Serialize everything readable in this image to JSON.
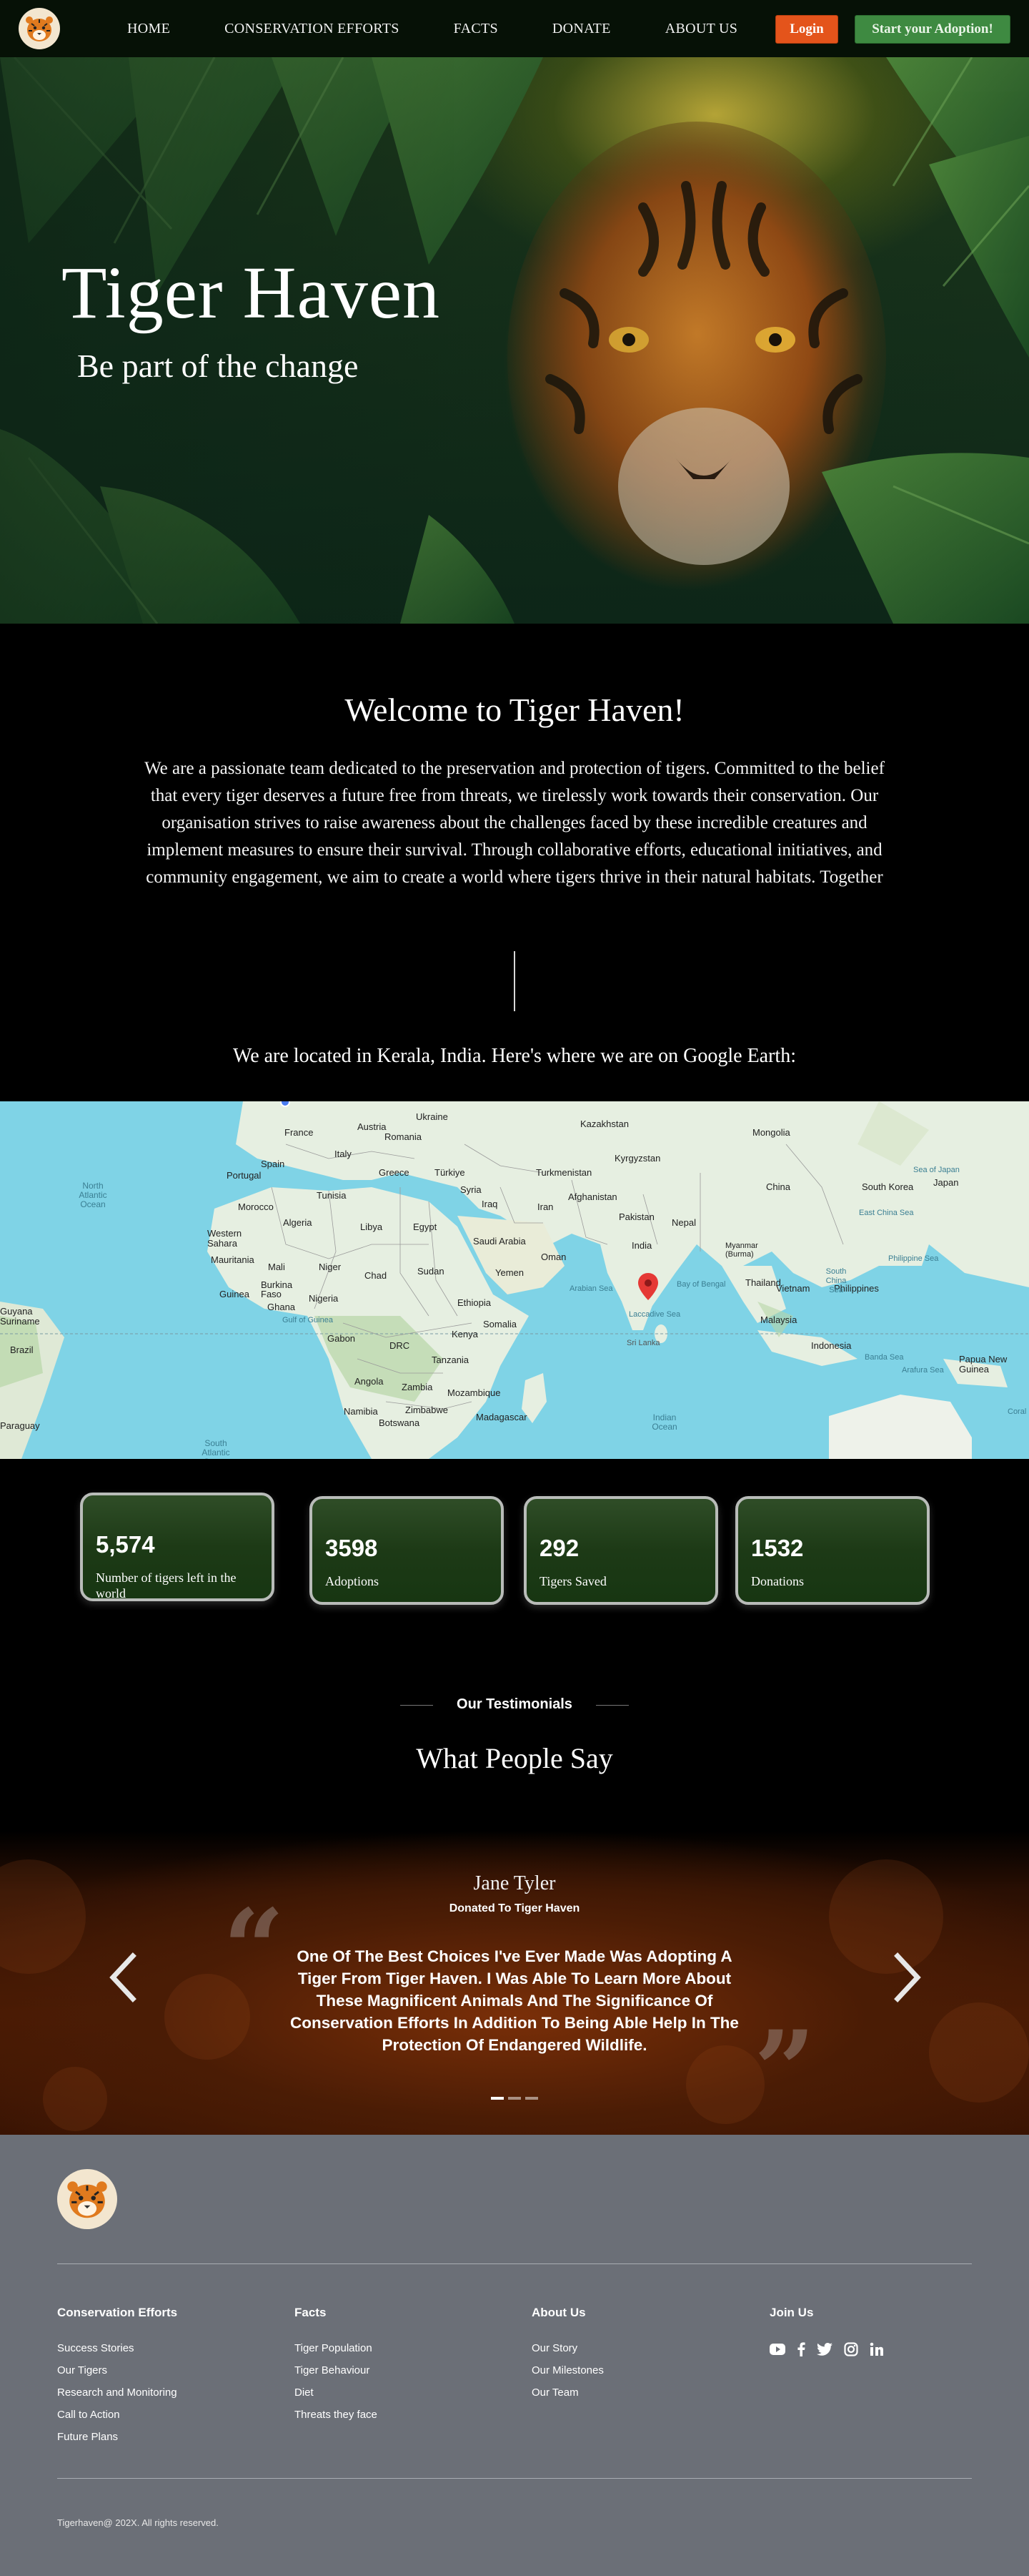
{
  "nav": {
    "logo_icon": "tiger-face-icon",
    "links": [
      "HOME",
      "CONSERVATION EFFORTS",
      "FACTS",
      "DONATE",
      "ABOUT US"
    ],
    "login_label": "Login",
    "adopt_label": "Start your Adoption!"
  },
  "hero": {
    "title": "Tiger Haven",
    "subtitle": "Be part of the change"
  },
  "welcome": {
    "title": "Welcome to Tiger Haven!",
    "text": "We are a passionate team dedicated to the preservation and protection of tigers. Committed to the belief that every tiger deserves a future free from threats, we tirelessly work towards their conservation. Our organisation strives to raise awareness about the challenges faced by these incredible creatures and implement measures to ensure their survival. Through collaborative efforts, educational initiatives, and community engagement, we aim to create a world where tigers thrive in their natural habitats. Together",
    "location": "We are located in Kerala, India. Here's where we are on Google Earth:"
  },
  "map": {
    "countries": [
      "Ukraine",
      "Kazakhstan",
      "Mongolia",
      "France",
      "Austria",
      "Romania",
      "Spain",
      "Italy",
      "Portugal",
      "Greece",
      "Türkiye",
      "Turkmenistan",
      "Kyrgyzstan",
      "China",
      "South Korea",
      "Japan",
      "Morocco",
      "Tunisia",
      "Syria",
      "Afghanistan",
      "Iraq",
      "Iran",
      "Pakistan",
      "Nepal",
      "Algeria",
      "Libya",
      "Egypt",
      "Saudi Arabia",
      "India",
      "Myanmar (Burma)",
      "Western Sahara",
      "Mauritania",
      "Mali",
      "Niger",
      "Chad",
      "Sudan",
      "Yemen",
      "Oman",
      "Thailand",
      "Vietnam",
      "Philippines",
      "Burkina Faso",
      "Nigeria",
      "Guinea",
      "Ghana",
      "Ethiopia",
      "Somalia",
      "Malaysia",
      "Gabon",
      "DRC",
      "Kenya",
      "Tanzania",
      "Indonesia",
      "Angola",
      "Zambia",
      "Mozambique",
      "Papua New Guinea",
      "Namibia",
      "Zimbabwe",
      "Botswana",
      "Madagascar",
      "Brazil",
      "Guyana",
      "Suriname",
      "Paraguay",
      "Sri Lanka"
    ],
    "oceans": [
      "North Atlantic Ocean",
      "Indian Ocean",
      "South Atlantic Ocean",
      "Arabian Sea",
      "Bay of Bengal",
      "Laccadive Sea",
      "Gulf of Guinea",
      "Sea of Japan",
      "East China Sea",
      "Philippine Sea",
      "South China Sea",
      "Banda Sea",
      "Arafura Sea",
      "Coral"
    ],
    "marker_icon": "map-pin-icon",
    "marker_color": "#e53935"
  },
  "stats": [
    {
      "value": "5,574",
      "label": "Number of tigers left in the world"
    },
    {
      "value": "3598",
      "label": "Adoptions"
    },
    {
      "value": "292",
      "label": "Tigers Saved"
    },
    {
      "value": "1532",
      "label": "Donations"
    }
  ],
  "testimonials": {
    "kicker": "Our Testimonials",
    "title": "What People Say",
    "name": "Jane Tyler",
    "role": "Donated To Tiger Haven",
    "quote": "One Of The Best Choices I've Ever Made Was Adopting A Tiger From Tiger Haven. I Was Able To Learn More About These Magnificent Animals And The Significance Of Conservation Efforts In Addition To Being Able Help In The Protection Of Endangered Wildlife.",
    "prev_icon": "chevron-left-icon",
    "next_icon": "chevron-right-icon",
    "slide_count": 3,
    "active_slide": 1
  },
  "footer": {
    "columns": [
      {
        "heading": "Conservation Efforts",
        "items": [
          "Success Stories",
          "Our Tigers",
          "Research and Monitoring",
          "Call to Action",
          "Future Plans"
        ]
      },
      {
        "heading": "Facts",
        "items": [
          "Tiger Population",
          "Tiger Behaviour",
          "Diet",
          "Threats they face"
        ]
      },
      {
        "heading": "About Us",
        "items": [
          "Our Story",
          "Our Milestones",
          "Our Team"
        ]
      }
    ],
    "join_heading": "Join Us",
    "social_icons": [
      "youtube-icon",
      "facebook-icon",
      "twitter-icon",
      "instagram-icon",
      "linkedin-icon"
    ],
    "copyright": "Tigerhaven@ 202X. All rights reserved."
  },
  "colors": {
    "nav_bg": "#061106",
    "login": "#e4541b",
    "adopt": "#3e8a41",
    "stat_bg": "#1d3a16",
    "footer_bg": "#6b6f77"
  }
}
